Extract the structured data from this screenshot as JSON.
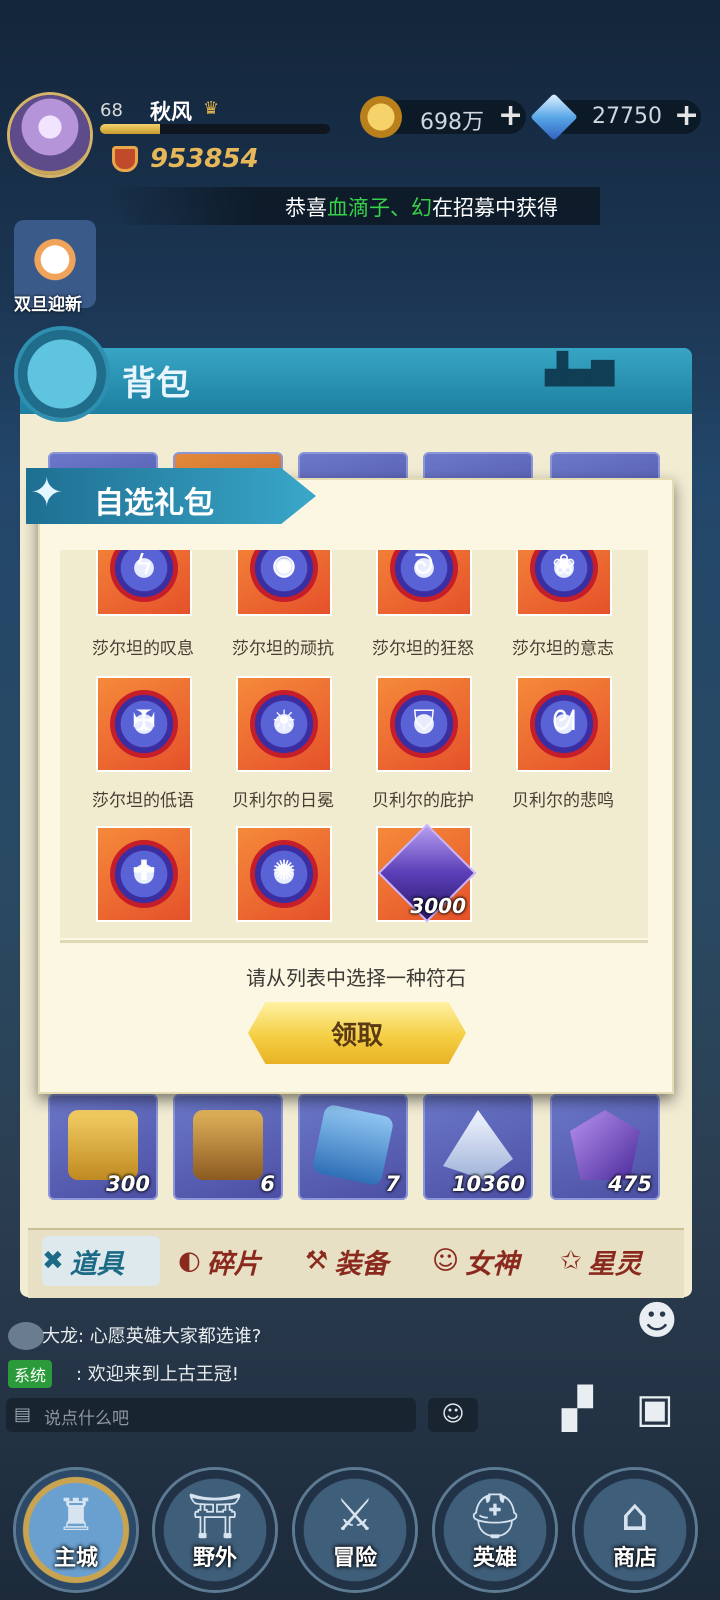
{
  "player": {
    "level": "68",
    "name": "秋风",
    "power": "953854",
    "xp_fraction": 0.26
  },
  "resources": {
    "gold": "698万",
    "diamonds": "27750"
  },
  "ticker": {
    "prefix": "恭喜",
    "highlight": "血滴子、幻",
    "suffix": "在招募中获得"
  },
  "event": {
    "label": "双旦迎新"
  },
  "backpack": {
    "title": "背包",
    "slots_bottom": [
      {
        "count": "300",
        "icon": "armor-card-icon"
      },
      {
        "count": "6",
        "icon": "treasure-chest-icon"
      },
      {
        "count": "7",
        "icon": "blue-card-icon"
      },
      {
        "count": "10360",
        "icon": "crystal-shard-icon"
      },
      {
        "count": "475",
        "icon": "purple-gem-icon"
      }
    ],
    "tabs": [
      {
        "label": "道具",
        "icon": "items-icon",
        "active": true
      },
      {
        "label": "碎片",
        "icon": "fragments-icon",
        "active": false
      },
      {
        "label": "装备",
        "icon": "equipment-icon",
        "active": false
      },
      {
        "label": "女神",
        "icon": "goddess-icon",
        "active": false
      },
      {
        "label": "星灵",
        "icon": "star-spirit-icon",
        "active": false
      }
    ]
  },
  "modal": {
    "title": "自选礼包",
    "items": [
      {
        "label": "莎尔坦的叹息"
      },
      {
        "label": "莎尔坦的顽抗"
      },
      {
        "label": "莎尔坦的狂怒"
      },
      {
        "label": "莎尔坦的意志"
      },
      {
        "label": "莎尔坦的低语"
      },
      {
        "label": "贝利尔的日冕"
      },
      {
        "label": "贝利尔的庇护"
      },
      {
        "label": "贝利尔的悲鸣"
      },
      {
        "label": ""
      },
      {
        "label": ""
      },
      {
        "label": "",
        "count": "3000"
      }
    ],
    "instruction": "请从列表中选择一种符石",
    "claim_button": "领取"
  },
  "chat": {
    "messages": [
      {
        "sender": "大龙",
        "text": "心愿英雄大家都选谁?"
      },
      {
        "sender": "系统",
        "text": ": 欢迎来到上古王冠!"
      }
    ],
    "placeholder": "说点什么吧"
  },
  "nav": [
    {
      "label": "主城"
    },
    {
      "label": "野外"
    },
    {
      "label": "冒险"
    },
    {
      "label": "英雄"
    },
    {
      "label": "商店"
    }
  ]
}
